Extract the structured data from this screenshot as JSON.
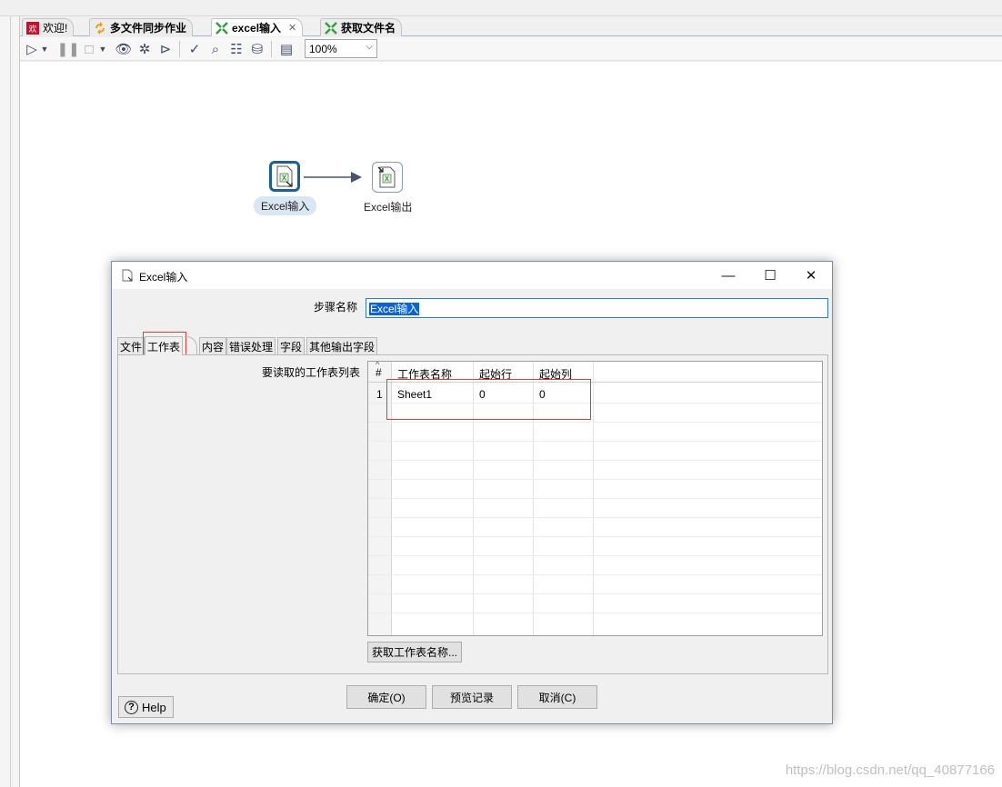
{
  "editor_tabs": [
    {
      "label": "欢迎!"
    },
    {
      "label": "多文件同步作业"
    },
    {
      "label": "excel输入"
    },
    {
      "label": "获取文件名"
    }
  ],
  "toolbar": {
    "zoom": "100%",
    "icons": [
      "run-icon",
      "dropdown-icon",
      "pause-icon",
      "stop-icon",
      "dropdown-icon",
      "preview-icon",
      "debug-icon",
      "replay-icon",
      "verify-icon",
      "analyze-icon",
      "sql-icon",
      "explore-db-icon",
      "show-results-icon"
    ]
  },
  "canvas": {
    "steps": [
      {
        "label": "Excel输入"
      },
      {
        "label": "Excel输出"
      }
    ]
  },
  "dialog": {
    "title": "Excel输入",
    "step_name_label": "步骤名称",
    "step_name_value": "Excel输入",
    "tabs": [
      {
        "label": "文件"
      },
      {
        "label": "工作表"
      },
      {
        "label": "内容"
      },
      {
        "label": "错误处理"
      },
      {
        "label": "字段"
      },
      {
        "label": "其他输出字段"
      }
    ],
    "sheet_list_label": "要读取的工作表列表",
    "table": {
      "columns": [
        "#",
        "工作表名称",
        "起始行",
        "起始列"
      ],
      "rows": [
        {
          "num": "1",
          "name": "Sheet1",
          "start_row": "0",
          "start_col": "0"
        }
      ]
    },
    "get_sheets_button": "获取工作表名称...",
    "ok_button": "确定(O)",
    "preview_button": "预览记录",
    "cancel_button": "取消(C)",
    "help_button": "Help"
  },
  "watermark": "https://blog.csdn.net/qq_40877166",
  "colors": {
    "accent": "#1b5f9a",
    "selection": "#0a64d8",
    "highlight_box": "#e23b3b"
  }
}
